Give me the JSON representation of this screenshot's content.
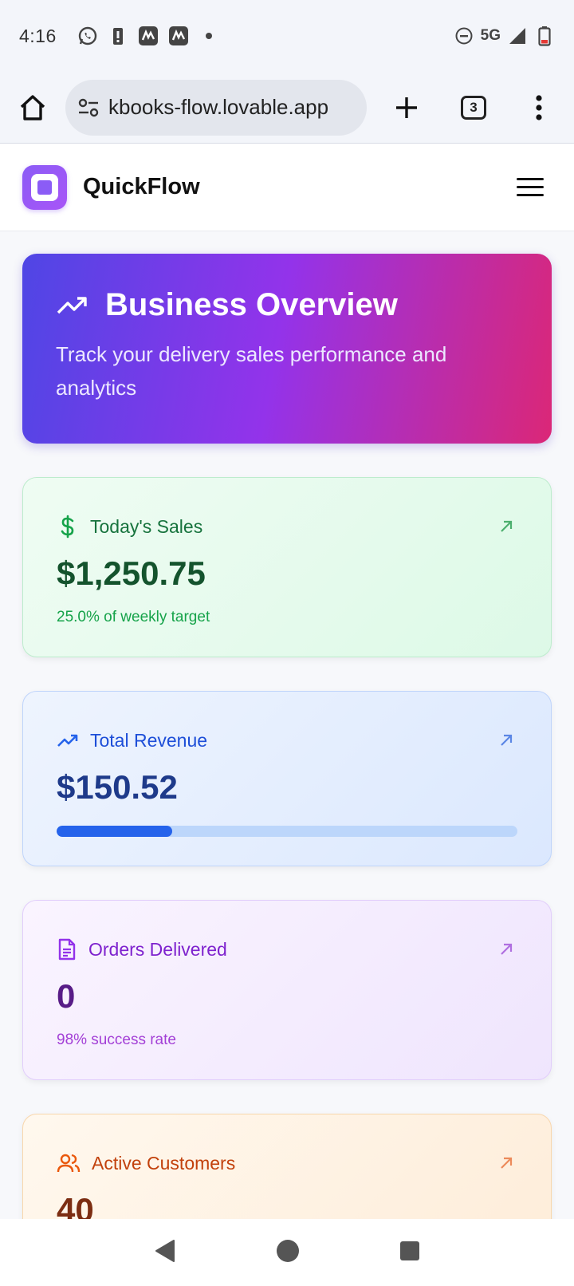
{
  "status_bar": {
    "time": "4:16",
    "network": "5G"
  },
  "browser": {
    "url": "kbooks-flow.lovable.app",
    "tab_count": "3"
  },
  "app": {
    "brand": "QuickFlow"
  },
  "hero": {
    "title": "Business Overview",
    "subtitle": "Track your delivery sales performance and analytics"
  },
  "cards": {
    "sales": {
      "label": "Today's Sales",
      "value": "$1,250.75",
      "note": "25.0% of weekly target"
    },
    "revenue": {
      "label": "Total Revenue",
      "value": "$150.52",
      "progress_percent": 25
    },
    "orders": {
      "label": "Orders Delivered",
      "value": "0",
      "note": "98% success rate"
    },
    "customers": {
      "label": "Active Customers",
      "value": "40"
    }
  },
  "colors": {
    "hero_gradient": [
      "#4f46e5",
      "#9333ea",
      "#db2777"
    ],
    "sales_accent": "#16a34a",
    "revenue_accent": "#2563eb",
    "orders_accent": "#9333ea",
    "customers_accent": "#ea580c"
  },
  "icons": {
    "status_left": [
      "whatsapp-icon",
      "battery-alert-icon",
      "app-notification-icon",
      "app-notification-icon",
      "dot-icon"
    ],
    "status_right": [
      "do-not-disturb-icon",
      "signal-icon",
      "battery-icon"
    ]
  }
}
